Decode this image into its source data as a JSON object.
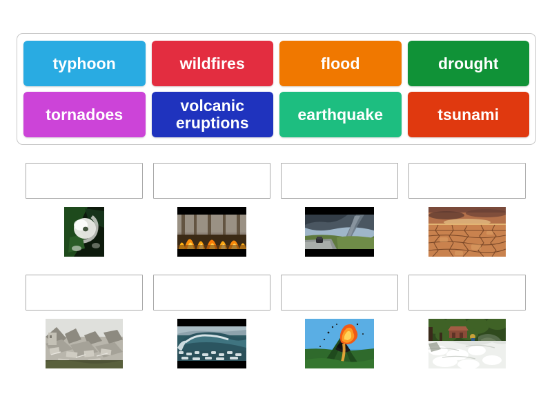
{
  "activity": {
    "type": "drag-and-drop-matching",
    "title": "Natural disasters matching activity"
  },
  "word_bank": {
    "rows": [
      [
        {
          "label": "typhoon",
          "color": "#29abe2",
          "icon": "word-tile-typhoon"
        },
        {
          "label": "wildfires",
          "color": "#e32d40",
          "icon": "word-tile-wildfires"
        },
        {
          "label": "flood",
          "color": "#f07800",
          "icon": "word-tile-flood"
        },
        {
          "label": "drought",
          "color": "#109237",
          "icon": "word-tile-drought"
        }
      ],
      [
        {
          "label": "tornadoes",
          "color": "#cc44d8",
          "icon": "word-tile-tornadoes"
        },
        {
          "label": "volcanic eruptions",
          "color": "#1f33be",
          "icon": "word-tile-volcanic-eruptions"
        },
        {
          "label": "earthquake",
          "color": "#1dbe80",
          "icon": "word-tile-earthquake"
        },
        {
          "label": "tsunami",
          "color": "#e0390f",
          "icon": "word-tile-tsunami"
        }
      ]
    ]
  },
  "answer_grid": {
    "drop_zone_placeholder": "",
    "rows": [
      [
        {
          "image_name": "typhoon-satellite-image",
          "answer": "",
          "thumb_width": 58,
          "thumb_height": 72,
          "letterbox": 0
        },
        {
          "image_name": "wildfire-forest-image",
          "answer": "",
          "thumb_width": 100,
          "thumb_height": 72,
          "letterbox": 11
        },
        {
          "image_name": "tornado-road-image",
          "answer": "",
          "thumb_width": 100,
          "thumb_height": 72,
          "letterbox": 11
        },
        {
          "image_name": "drought-cracked-earth-image",
          "answer": "",
          "thumb_width": 112,
          "thumb_height": 72,
          "letterbox": 0
        }
      ],
      [
        {
          "image_name": "earthquake-rubble-image",
          "answer": "",
          "thumb_width": 112,
          "thumb_height": 72,
          "letterbox": 0
        },
        {
          "image_name": "tsunami-wave-image",
          "answer": "",
          "thumb_width": 100,
          "thumb_height": 72,
          "letterbox": 11
        },
        {
          "image_name": "volcanic-eruption-image",
          "answer": "",
          "thumb_width": 100,
          "thumb_height": 72,
          "letterbox": 0
        },
        {
          "image_name": "flood-river-image",
          "answer": "",
          "thumb_width": 112,
          "thumb_height": 72,
          "letterbox": 0
        }
      ]
    ]
  },
  "colors": {
    "page_background": "#ffffff",
    "container_border": "#c7c7c7",
    "drop_zone_border": "#a8a8a8",
    "tile_text": "#ffffff"
  }
}
